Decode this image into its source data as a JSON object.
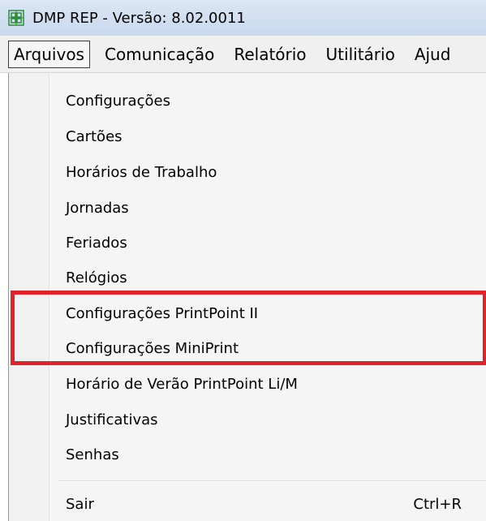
{
  "window": {
    "title": "DMP REP - Versão: 8.02.0011",
    "app_icon": "app-logo-icon"
  },
  "menubar": {
    "items": [
      {
        "label": "Arquivos",
        "active": true
      },
      {
        "label": "Comunicação",
        "active": false
      },
      {
        "label": "Relatório",
        "active": false
      },
      {
        "label": "Utilitário",
        "active": false
      },
      {
        "label": "Ajud",
        "active": false
      }
    ]
  },
  "dropdown": {
    "items": [
      {
        "label": "Configurações"
      },
      {
        "label": "Cartões"
      },
      {
        "label": "Horários de Trabalho"
      },
      {
        "label": "Jornadas"
      },
      {
        "label": "Feriados"
      },
      {
        "label": "Relógios"
      },
      {
        "label": "Configurações PrintPoint II"
      },
      {
        "label": "Configurações MiniPrint"
      },
      {
        "label": "Horário de Verão PrintPoint Li/M"
      },
      {
        "label": "Justificativas"
      },
      {
        "label": "Senhas"
      }
    ],
    "exit": {
      "label": "Sair",
      "shortcut": "Ctrl+R"
    }
  },
  "annotation": {
    "highlight_color": "#e0232a"
  }
}
